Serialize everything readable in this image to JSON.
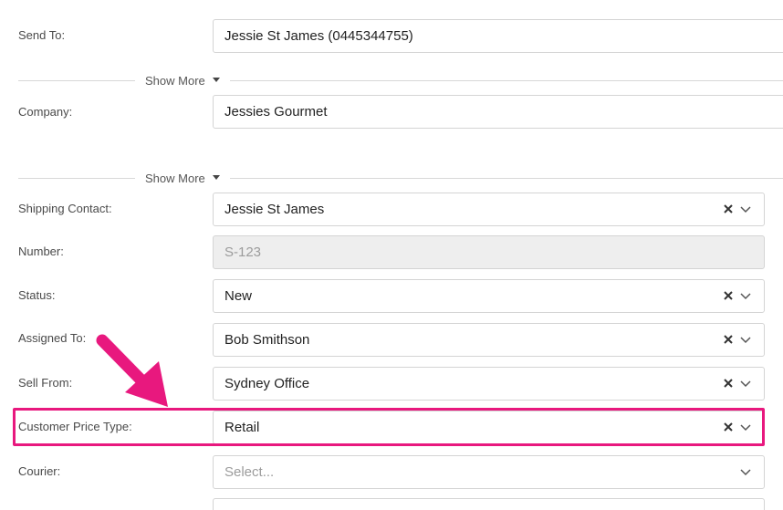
{
  "form": {
    "send_to": {
      "label": "Send To:",
      "value": "Jessie St James (0445344755)"
    },
    "show_more_1": {
      "label": "Show More"
    },
    "company": {
      "label": "Company:",
      "value": "Jessies Gourmet"
    },
    "show_more_2": {
      "label": "Show More"
    },
    "shipping_contact": {
      "label": "Shipping Contact:",
      "value": "Jessie St James"
    },
    "number": {
      "label": "Number:",
      "value": "S-123"
    },
    "status": {
      "label": "Status:",
      "value": "New"
    },
    "assigned_to": {
      "label": "Assigned To:",
      "value": "Bob Smithson"
    },
    "sell_from": {
      "label": "Sell From:",
      "value": "Sydney Office"
    },
    "customer_price_type": {
      "label": "Customer Price Type:",
      "value": "Retail"
    },
    "courier": {
      "label": "Courier:",
      "placeholder": "Select..."
    }
  },
  "icons": {
    "clear": "close-icon",
    "dropdown": "chevron-down-icon",
    "expand": "caret-down-icon"
  },
  "colors": {
    "highlight": "#e8187e",
    "border": "#d4d4d4",
    "disabled_bg": "#eeeeee"
  }
}
